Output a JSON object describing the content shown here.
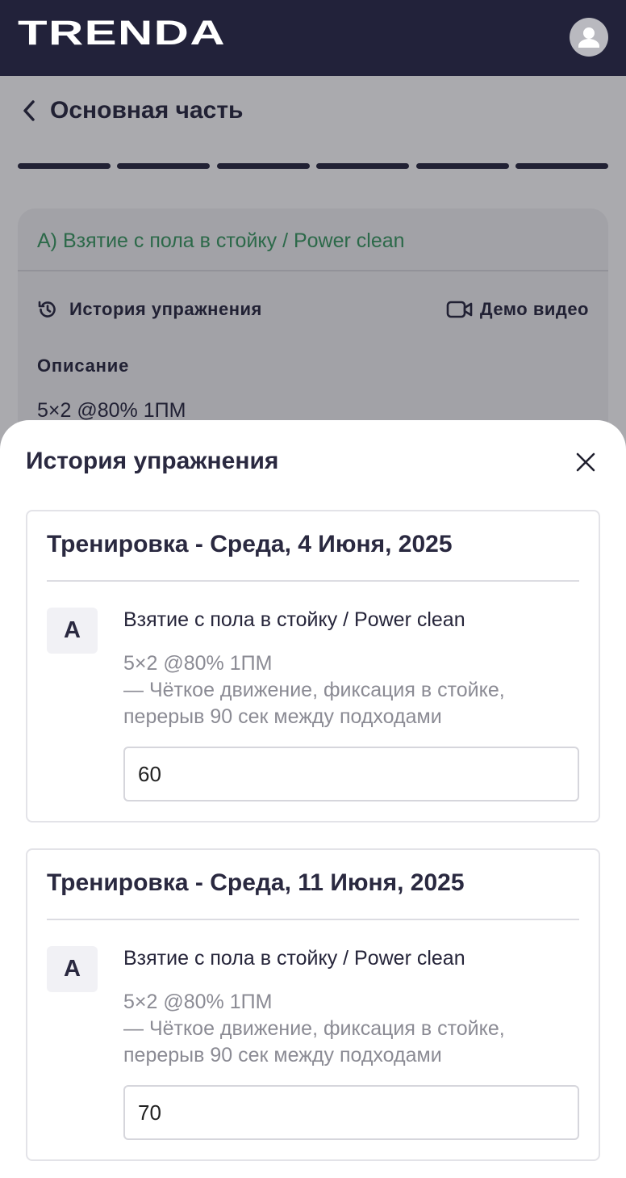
{
  "header": {
    "logo_text": "TRENDA",
    "avatar_icon": "user-avatar-icon"
  },
  "page": {
    "back_icon": "chevron-left-icon",
    "title": "Основная часть",
    "progress_segments": 6,
    "exercise": {
      "name": "A) Взятие с пола в стойку / Power clean",
      "history_label": "История упражнения",
      "demo_label": "Демо видео",
      "description_heading": "Описание",
      "description": "5×2 @80% 1ПМ"
    }
  },
  "sheet": {
    "title": "История упражнения",
    "close_icon": "close-icon",
    "cards": [
      {
        "title": "Тренировка - Среда, 4 Июня, 2025",
        "letter": "A",
        "exercise_title": "Взятие с пола в стойку / Power clean",
        "scheme": "5×2 @80% 1ПМ",
        "note_line1": "— Чёткое движение, фиксация в стойке,",
        "note_line2": "перерыв 90 сек между подходами",
        "weight_value": "60"
      },
      {
        "title": "Тренировка - Среда, 11 Июня, 2025",
        "letter": "A",
        "exercise_title": "Взятие с пола в стойку / Power clean",
        "scheme": "5×2 @80% 1ПМ",
        "note_line1": "— Чёткое движение, фиксация в стойке,",
        "note_line2": "перерыв 90 сек между подходами",
        "weight_value": "70"
      }
    ]
  },
  "colors": {
    "header_bg": "#22223a",
    "exercise_name": "#3b9a62",
    "text_primary": "#2a2940",
    "text_muted": "#8b8b94"
  }
}
